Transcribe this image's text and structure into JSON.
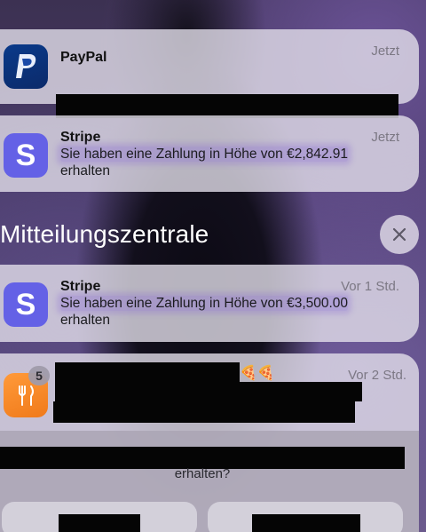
{
  "notifications": [
    {
      "app": "PayPal",
      "time": "Jetzt",
      "icon": "paypal-icon"
    },
    {
      "app": "Stripe",
      "time": "Jetzt",
      "message_line1": "Sie haben eine Zahlung in Höhe von €2,842.91",
      "message_line2": "erhalten",
      "icon": "stripe-icon"
    }
  ],
  "notification_center": {
    "title": "Mitteilungszentrale",
    "close_icon": "close-icon"
  },
  "center_notifications": [
    {
      "app": "Stripe",
      "time": "Vor 1 Std.",
      "message_line1": "Sie haben eine Zahlung in Höhe von €3,500.00",
      "message_line2": "erhalten",
      "icon": "stripe-icon"
    },
    {
      "time": "Vor 2 Std.",
      "badge": "5",
      "emoji": "🍕🍕",
      "icon": "food-delivery-icon"
    }
  ],
  "expanded_prompt": {
    "text": "erhalten?"
  },
  "colors": {
    "stripe": "#6461e6",
    "paypal": "#0b2a6a",
    "food": "#f07a1a",
    "highlight": "#8c6ed2"
  }
}
